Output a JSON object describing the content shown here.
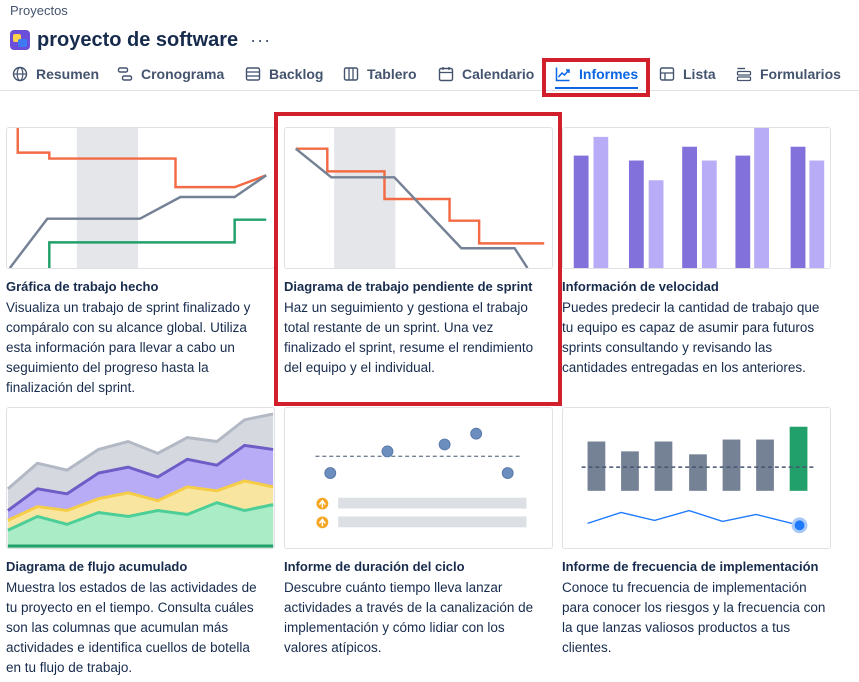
{
  "breadcrumb": "Proyectos",
  "project": {
    "title": "proyecto de software",
    "more": "···"
  },
  "tabs": [
    {
      "label": "Resumen",
      "icon": "globe-icon"
    },
    {
      "label": "Cronograma",
      "icon": "timeline-icon"
    },
    {
      "label": "Backlog",
      "icon": "backlog-icon"
    },
    {
      "label": "Tablero",
      "icon": "board-icon"
    },
    {
      "label": "Calendario",
      "icon": "calendar-icon"
    },
    {
      "label": "Informes",
      "icon": "chart-line-icon",
      "active": true
    },
    {
      "label": "Lista",
      "icon": "list-icon"
    },
    {
      "label": "Formularios",
      "icon": "forms-icon"
    }
  ],
  "cards": [
    {
      "title": "Gráfica de trabajo hecho",
      "lines": [
        "Visualiza un trabajo de sprint finalizado y",
        "compáralo con su alcance global. Utiliza",
        "esta información para llevar a cabo un",
        "seguimiento del progreso hasta la",
        "finalización del sprint."
      ]
    },
    {
      "title": "Diagrama de trabajo pendiente de sprint",
      "lines": [
        "Haz un seguimiento y gestiona el trabajo",
        "total restante de un sprint. Una vez",
        "finalizado el sprint, resume el rendimiento",
        "del equipo y el individual."
      ]
    },
    {
      "title": "Información de velocidad",
      "lines": [
        "Puedes predecir la cantidad de trabajo que",
        "tu equipo es capaz de asumir para futuros",
        "sprints consultando y revisando las",
        "cantidades entregadas en los anteriores."
      ]
    },
    {
      "title": "Diagrama de flujo acumulado",
      "lines": [
        "Muestra los estados de las actividades de",
        "tu proyecto en el tiempo. Consulta cuáles",
        "son las columnas que acumulan más",
        "actividades e identifica cuellos de botella",
        "en tu flujo de trabajo."
      ]
    },
    {
      "title": "Informe de duración del ciclo",
      "lines": [
        "Descubre cuánto tiempo lleva lanzar",
        "actividades a través de la canalización de",
        "implementación y cómo lidiar con los",
        "valores atípicos."
      ]
    },
    {
      "title": "Informe de frecuencia de implementación",
      "lines": [
        "Conoce tu frecuencia de implementación",
        "para conocer los riesgos y la frecuencia con",
        "la que lanzas valiosos productos a tus",
        "clientes."
      ]
    }
  ],
  "colors": {
    "accent": "#0c66e4",
    "highlight": "#d1202b",
    "orange": "#f26b45",
    "slate": "#758195",
    "green": "#22a06b",
    "purple": "#8270db",
    "lavender": "#b8acf6"
  }
}
